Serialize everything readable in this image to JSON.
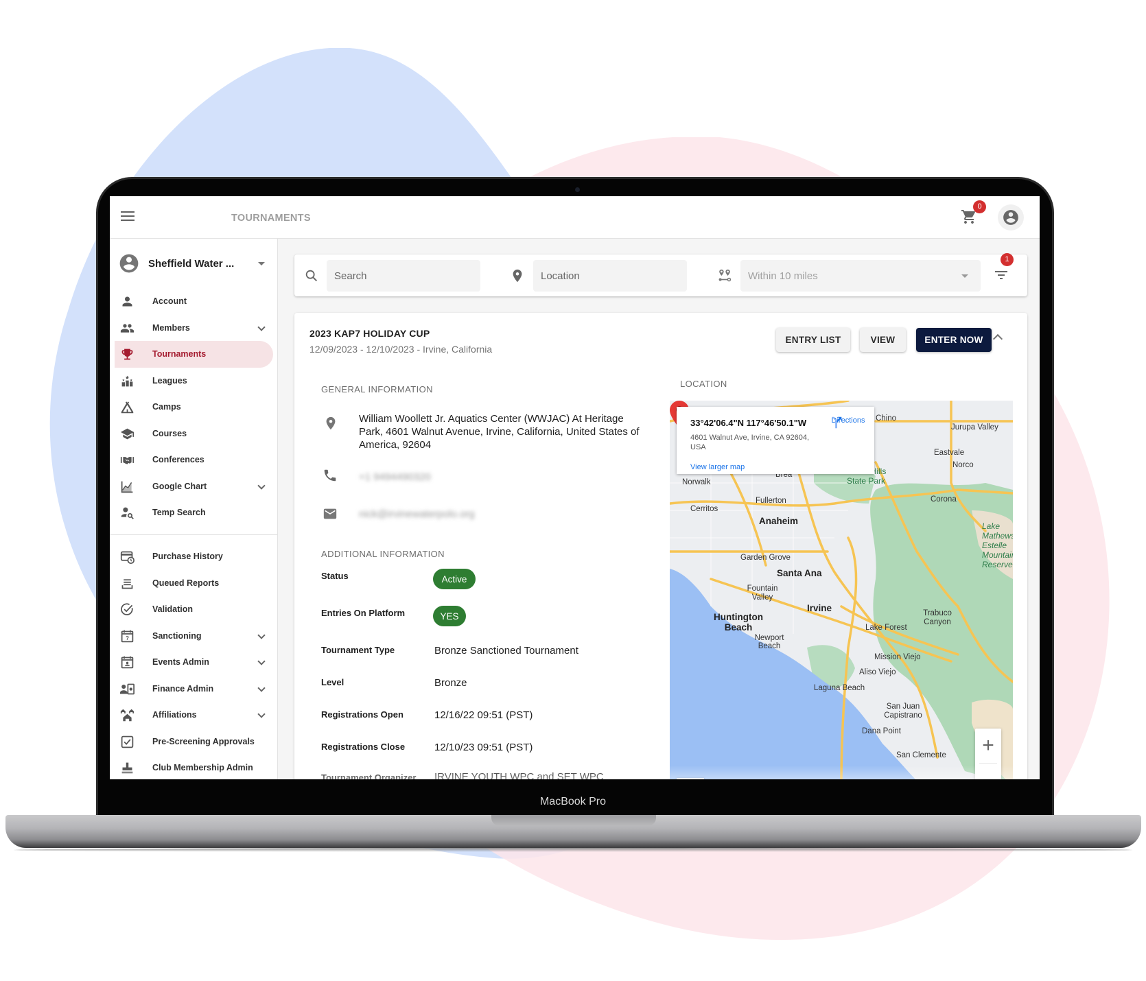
{
  "device": {
    "label": "MacBook Pro"
  },
  "header": {
    "title": "TOURNAMENTS",
    "cart_count": "0"
  },
  "sidebar": {
    "org_name": "Sheffield Water ...",
    "items": [
      {
        "label": "Account",
        "icon": "person-icon",
        "expandable": false,
        "active": false
      },
      {
        "label": "Members",
        "icon": "people-icon",
        "expandable": true,
        "active": false
      },
      {
        "label": "Tournaments",
        "icon": "trophy-icon",
        "expandable": false,
        "active": true
      },
      {
        "label": "Leagues",
        "icon": "leaderboard-icon",
        "expandable": false,
        "active": false
      },
      {
        "label": "Camps",
        "icon": "tent-icon",
        "expandable": false,
        "active": false
      },
      {
        "label": "Courses",
        "icon": "school-icon",
        "expandable": false,
        "active": false
      },
      {
        "label": "Conferences",
        "icon": "handshake-icon",
        "expandable": false,
        "active": false
      },
      {
        "label": "Google Chart",
        "icon": "chart-icon",
        "expandable": true,
        "active": false
      },
      {
        "label": "Temp Search",
        "icon": "person-search-icon",
        "expandable": false,
        "active": false
      }
    ],
    "admin_items": [
      {
        "label": "Purchase History",
        "icon": "payment-history-icon",
        "expandable": false
      },
      {
        "label": "Queued Reports",
        "icon": "queue-icon",
        "expandable": false
      },
      {
        "label": "Validation",
        "icon": "check-circle-icon",
        "expandable": false
      },
      {
        "label": "Sanctioning",
        "icon": "calendar-question-icon",
        "expandable": true
      },
      {
        "label": "Events Admin",
        "icon": "event-icon",
        "expandable": true
      },
      {
        "label": "Finance Admin",
        "icon": "finance-icon",
        "expandable": true
      },
      {
        "label": "Affiliations",
        "icon": "houses-icon",
        "expandable": true
      },
      {
        "label": "Pre-Screening Approvals",
        "icon": "checkbox-icon",
        "expandable": false
      },
      {
        "label": "Club Membership Admin",
        "icon": "stamp-icon",
        "expandable": false
      }
    ]
  },
  "filters": {
    "search_placeholder": "Search",
    "location_placeholder": "Location",
    "distance_value": "Within 10 miles",
    "active_filter_count": "1"
  },
  "tournament": {
    "title": "2023 KAP7 HOLIDAY CUP",
    "subtitle": "12/09/2023 - 12/10/2023 - Irvine, California",
    "buttons": {
      "entry_list": "ENTRY LIST",
      "view": "VIEW",
      "enter_now": "ENTER NOW"
    },
    "general_heading": "GENERAL INFORMATION",
    "address": "William Woollett Jr. Aquatics Center (WWJAC) At Heritage Park, 4601 Walnut Avenue, Irvine, California, United States of America, 92604",
    "phone": "+1 9494490320",
    "email": "nick@irvinewaterpolo.org",
    "additional_heading": "ADDITIONAL INFORMATION",
    "status_label": "Status",
    "status_value": "Active",
    "entries_label": "Entries On Platform",
    "entries_value": "YES",
    "details": [
      {
        "label": "Tournament Type",
        "value": "Bronze Sanctioned Tournament"
      },
      {
        "label": "Level",
        "value": "Bronze"
      },
      {
        "label": "Registrations Open",
        "value": "12/16/22 09:51 (PST)"
      },
      {
        "label": "Registrations Close",
        "value": "12/10/23 09:51 (PST)"
      },
      {
        "label": "Tournament Organizer",
        "value": "IRVINE YOUTH WPC and SET WPC"
      }
    ],
    "location_heading": "LOCATION"
  },
  "map": {
    "coords": "33°42'06.4\"N 117°46'50.1\"W",
    "address": "4601 Walnut Ave, Irvine, CA 92604, USA",
    "directions_label": "Directions",
    "larger_map_label": "View larger map",
    "zoom_in": "+",
    "zoom_out": "−",
    "attribution": "Google",
    "places": [
      {
        "name": "Chino",
        "cls": ""
      },
      {
        "name": "Jurupa Valley",
        "cls": ""
      },
      {
        "name": "Eastvale",
        "cls": ""
      },
      {
        "name": "Norco",
        "cls": ""
      },
      {
        "name": "Chino Hills State Park",
        "cls": "park"
      },
      {
        "name": "Brea",
        "cls": ""
      },
      {
        "name": "Norwalk",
        "cls": ""
      },
      {
        "name": "Fullerton",
        "cls": ""
      },
      {
        "name": "Cerritos",
        "cls": ""
      },
      {
        "name": "Corona",
        "cls": ""
      },
      {
        "name": "Anaheim",
        "cls": "big"
      },
      {
        "name": "Lake Mathews Estelle Mountain Reserve",
        "cls": "green"
      },
      {
        "name": "Garden Grove",
        "cls": ""
      },
      {
        "name": "Santa Ana",
        "cls": "big"
      },
      {
        "name": "Fountain Valley",
        "cls": ""
      },
      {
        "name": "Irvine",
        "cls": "big"
      },
      {
        "name": "Huntington Beach",
        "cls": "big"
      },
      {
        "name": "Trabuco Canyon",
        "cls": ""
      },
      {
        "name": "Lake Forest",
        "cls": ""
      },
      {
        "name": "Newport Beach",
        "cls": ""
      },
      {
        "name": "Mission Viejo",
        "cls": ""
      },
      {
        "name": "Aliso Viejo",
        "cls": ""
      },
      {
        "name": "Laguna Beach",
        "cls": ""
      },
      {
        "name": "San Juan Capistrano",
        "cls": ""
      },
      {
        "name": "Dana Point",
        "cls": ""
      },
      {
        "name": "San Clemente",
        "cls": ""
      }
    ]
  },
  "colors": {
    "brand_navy": "#0c1a3e",
    "active_nav": "#a51c30",
    "active_nav_bg": "#f6e3e5",
    "status_green": "#2e7d32",
    "badge_red": "#d32f2f"
  }
}
